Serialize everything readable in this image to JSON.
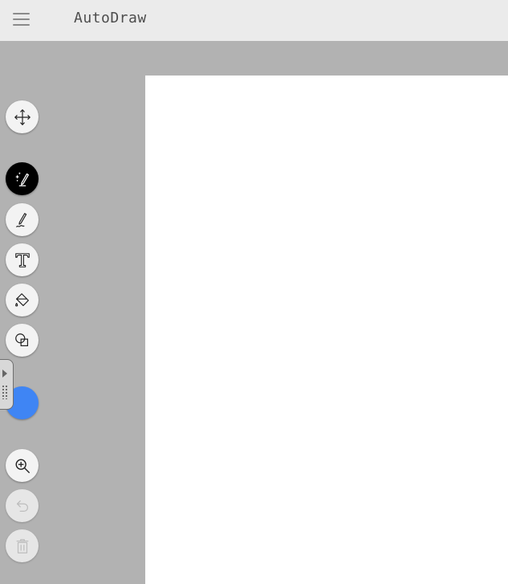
{
  "header": {
    "title": "AutoDraw",
    "background": "#ebebeb"
  },
  "toolbar": {
    "tools": [
      {
        "name": "move-tool",
        "icon": "move-arrows-icon",
        "active": false,
        "disabled": false
      },
      {
        "name": "autodraw-tool",
        "icon": "magic-pen-icon",
        "active": true,
        "disabled": false
      },
      {
        "name": "draw-tool",
        "icon": "pencil-squiggle-icon",
        "active": false,
        "disabled": false
      },
      {
        "name": "type-tool",
        "icon": "text-t-icon",
        "active": false,
        "disabled": false
      },
      {
        "name": "fill-tool",
        "icon": "paint-bucket-icon",
        "active": false,
        "disabled": false
      },
      {
        "name": "shape-tool",
        "icon": "shapes-icon",
        "active": false,
        "disabled": false
      },
      {
        "name": "zoom-tool",
        "icon": "zoom-in-icon",
        "active": false,
        "disabled": false
      },
      {
        "name": "undo-button",
        "icon": "undo-icon",
        "active": false,
        "disabled": true
      },
      {
        "name": "delete-button",
        "icon": "trash-icon",
        "active": false,
        "disabled": true
      }
    ],
    "selected_color": "#3f85f4"
  },
  "colors": {
    "workspace": "#b2b2b2",
    "canvas": "#ffffff",
    "active_tool": "#000000"
  }
}
